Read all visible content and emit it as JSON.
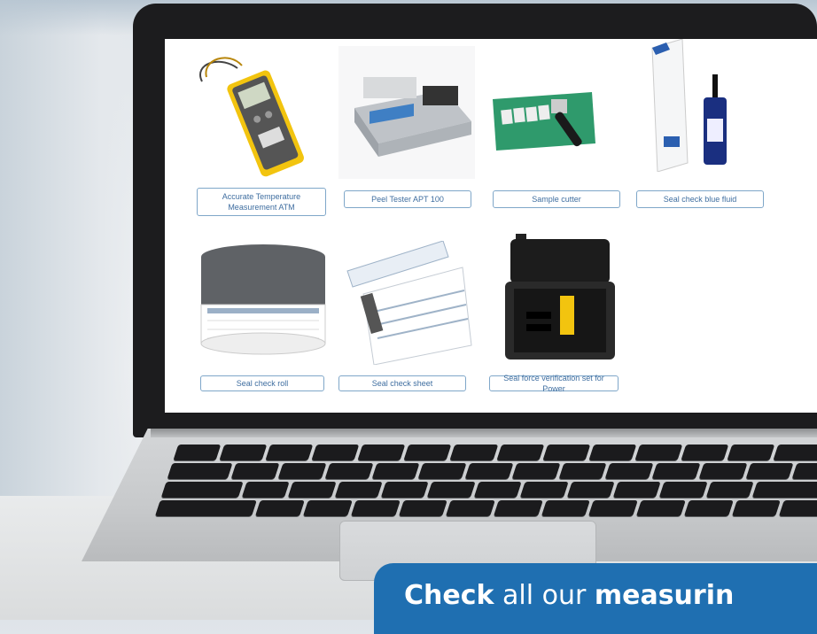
{
  "products": [
    {
      "label": "Accurate Temperature Measurement ATM",
      "icon": "thermometer-device-image"
    },
    {
      "label": "Peel Tester APT 100",
      "icon": "peel-tester-image"
    },
    {
      "label": "Sample cutter",
      "icon": "sample-cutter-image"
    },
    {
      "label": "Seal check blue fluid",
      "icon": "blue-fluid-bottle-image"
    },
    {
      "label": "Seal check roll",
      "icon": "tape-roll-image"
    },
    {
      "label": "Seal check sheet",
      "icon": "seal-sheets-image"
    },
    {
      "label": "Seal force verification set for Power",
      "icon": "carry-case-image"
    }
  ],
  "cta": {
    "part1": "Check",
    "part2": " all our ",
    "part3": "measurin"
  },
  "colors": {
    "accent": "#1f6fb1",
    "label_border": "#7fa7c9",
    "label_text": "#3f6ea0"
  }
}
